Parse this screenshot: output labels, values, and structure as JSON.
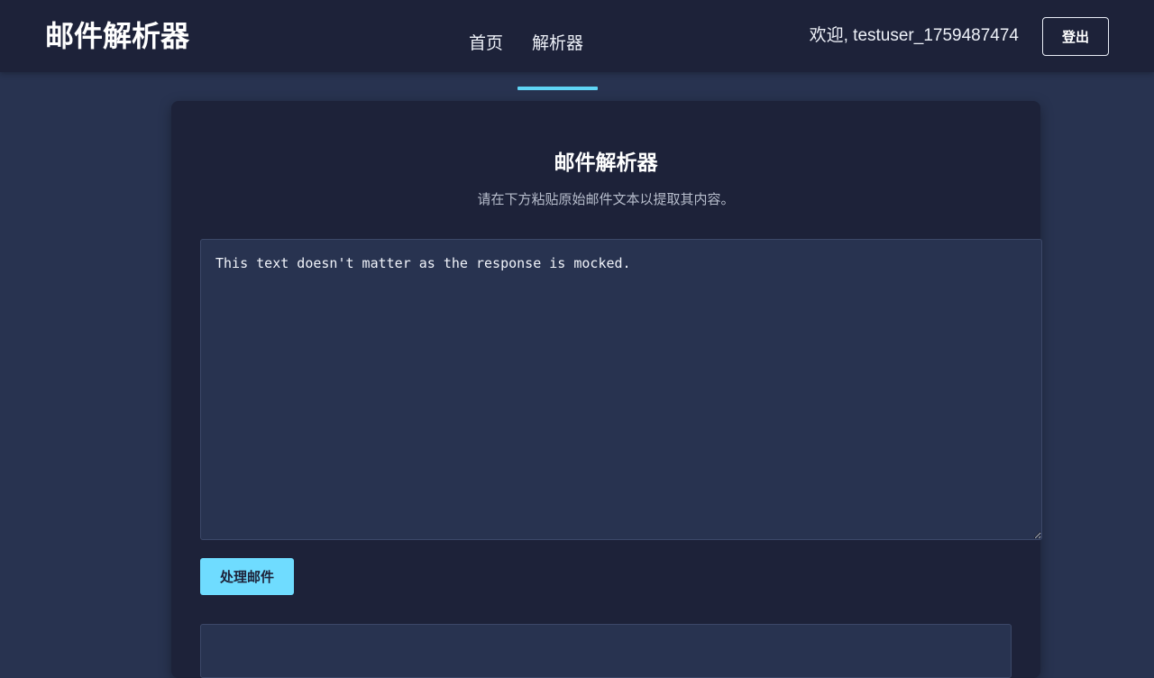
{
  "navbar": {
    "brand": "邮件解析器",
    "links": [
      {
        "label": "首页",
        "active": false
      },
      {
        "label": "解析器",
        "active": true
      }
    ],
    "welcome": "欢迎, testuser_1759487474",
    "logout_label": "登出"
  },
  "main": {
    "title": "邮件解析器",
    "subtitle": "请在下方粘贴原始邮件文本以提取其内容。",
    "textarea_value": "This text doesn't matter as the response is mocked.",
    "process_label": "处理邮件"
  },
  "colors": {
    "accent": "#6fdcff",
    "navbar_bg": "#1d2239",
    "page_bg": "#283350"
  }
}
